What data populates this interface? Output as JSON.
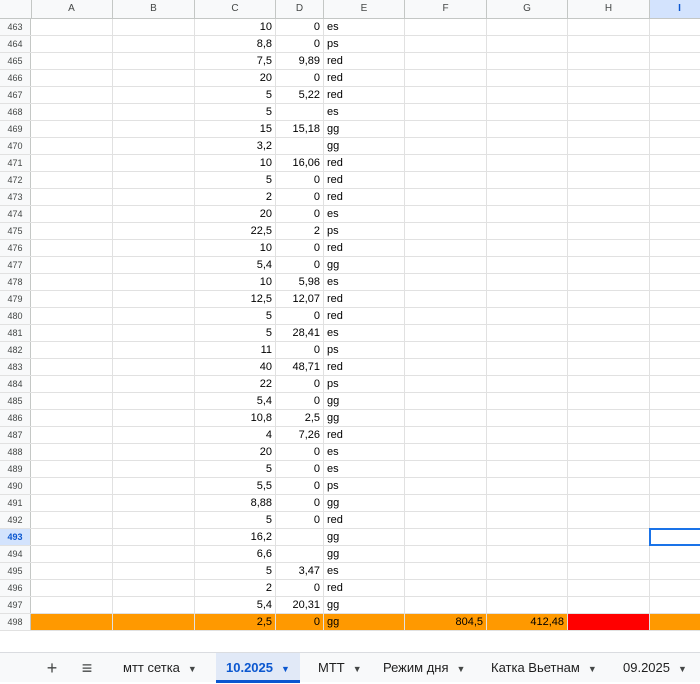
{
  "columns": [
    "A",
    "B",
    "C",
    "D",
    "E",
    "F",
    "G",
    "H",
    "I"
  ],
  "selected_column": "I",
  "selected_row": "493",
  "rows": [
    {
      "n": "463",
      "C": "10",
      "D": "0",
      "E": "es"
    },
    {
      "n": "464",
      "C": "8,8",
      "D": "0",
      "E": "ps"
    },
    {
      "n": "465",
      "C": "7,5",
      "D": "9,89",
      "E": "red"
    },
    {
      "n": "466",
      "C": "20",
      "D": "0",
      "E": "red"
    },
    {
      "n": "467",
      "C": "5",
      "D": "5,22",
      "E": "red"
    },
    {
      "n": "468",
      "C": "5",
      "D": "",
      "E": "es"
    },
    {
      "n": "469",
      "C": "15",
      "D": "15,18",
      "E": "gg"
    },
    {
      "n": "470",
      "C": "3,2",
      "D": "",
      "E": "gg"
    },
    {
      "n": "471",
      "C": "10",
      "D": "16,06",
      "E": "red"
    },
    {
      "n": "472",
      "C": "5",
      "D": "0",
      "E": "red"
    },
    {
      "n": "473",
      "C": "2",
      "D": "0",
      "E": "red"
    },
    {
      "n": "474",
      "C": "20",
      "D": "0",
      "E": "es"
    },
    {
      "n": "475",
      "C": "22,5",
      "D": "2",
      "E": "ps"
    },
    {
      "n": "476",
      "C": "10",
      "D": "0",
      "E": "red"
    },
    {
      "n": "477",
      "C": "5,4",
      "D": "0",
      "E": "gg"
    },
    {
      "n": "478",
      "C": "10",
      "D": "5,98",
      "E": "es"
    },
    {
      "n": "479",
      "C": "12,5",
      "D": "12,07",
      "E": "red"
    },
    {
      "n": "480",
      "C": "5",
      "D": "0",
      "E": "red"
    },
    {
      "n": "481",
      "C": "5",
      "D": "28,41",
      "E": "es"
    },
    {
      "n": "482",
      "C": "11",
      "D": "0",
      "E": "ps"
    },
    {
      "n": "483",
      "C": "40",
      "D": "48,71",
      "E": "red"
    },
    {
      "n": "484",
      "C": "22",
      "D": "0",
      "E": "ps"
    },
    {
      "n": "485",
      "C": "5,4",
      "D": "0",
      "E": "gg"
    },
    {
      "n": "486",
      "C": "10,8",
      "D": "2,5",
      "E": "gg"
    },
    {
      "n": "487",
      "C": "4",
      "D": "7,26",
      "E": "red"
    },
    {
      "n": "488",
      "C": "20",
      "D": "0",
      "E": "es"
    },
    {
      "n": "489",
      "C": "5",
      "D": "0",
      "E": "es"
    },
    {
      "n": "490",
      "C": "5,5",
      "D": "0",
      "E": "ps"
    },
    {
      "n": "491",
      "C": "8,88",
      "D": "0",
      "E": "gg"
    },
    {
      "n": "492",
      "C": "5",
      "D": "0",
      "E": "red"
    },
    {
      "n": "493",
      "C": "16,2",
      "D": "",
      "E": "gg"
    },
    {
      "n": "494",
      "C": "6,6",
      "D": "",
      "E": "gg"
    },
    {
      "n": "495",
      "C": "5",
      "D": "3,47",
      "E": "es"
    },
    {
      "n": "496",
      "C": "2",
      "D": "0",
      "E": "red"
    },
    {
      "n": "497",
      "C": "5,4",
      "D": "20,31",
      "E": "gg"
    },
    {
      "n": "498",
      "C": "2,5",
      "D": "0",
      "E": "gg",
      "F": "804,5",
      "G": "412,48",
      "highlight": true
    }
  ],
  "highlight_colors": {
    "row": "#ff9900",
    "cell_H": "#ff0000"
  },
  "tabbar": {
    "add_icon": "+",
    "menu_icon": "≡",
    "tabs": [
      {
        "label": "мтт сетка",
        "active": false
      },
      {
        "label": "10.2025",
        "active": true
      },
      {
        "label": "МТТ",
        "active": false
      },
      {
        "label": "Режим дня",
        "active": false
      },
      {
        "label": "Катка Вьетнам",
        "active": false
      },
      {
        "label": "09.2025",
        "active": false
      }
    ]
  }
}
